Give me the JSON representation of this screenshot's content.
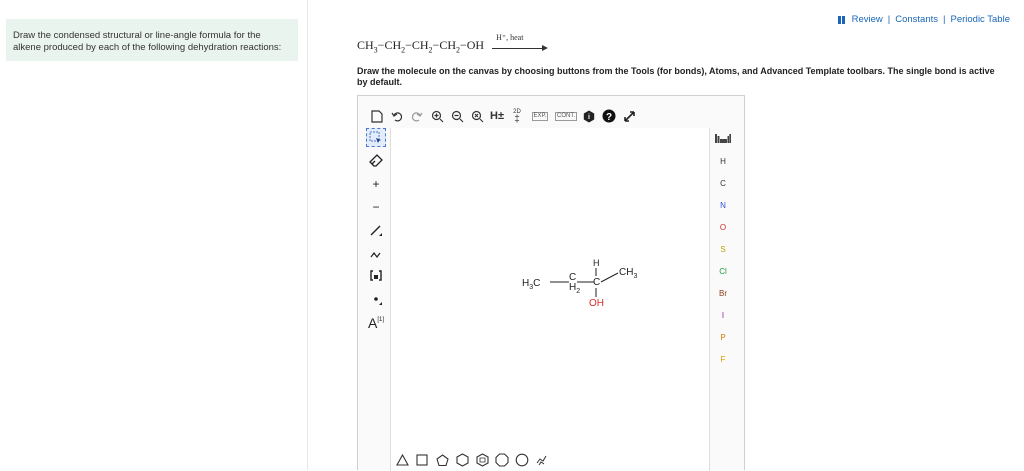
{
  "question": {
    "text": "Draw the condensed structural or line-angle formula for the alkene produced by each of the following dehydration reactions:"
  },
  "top_links": {
    "review": "Review",
    "constants": "Constants",
    "periodic_table": "Periodic Table",
    "separator": "|"
  },
  "reaction": {
    "reactant_parts": [
      "CH",
      "3",
      "−CH",
      "2",
      "−CH",
      "2",
      "−CH",
      "2",
      "−OH"
    ],
    "conditions": "H⁺, heat"
  },
  "instructions": "Draw the molecule on the canvas by choosing buttons from the Tools (for bonds), Atoms, and Advanced Template toolbars. The single bond is active by default.",
  "editor": {
    "top_toolbar": [
      "new-icon",
      "undo-icon",
      "redo-icon",
      "zoom-in-icon",
      "zoom-out-icon",
      "clean-icon",
      "hydrogen-toggle-icon",
      "2d-icon",
      "expand-icon",
      "contract-icon",
      "info-icon",
      "help-icon",
      "fullscreen-icon"
    ],
    "top_toolbar_labels": {
      "h_toggle": "H±",
      "d2": "2D",
      "exp": "EXP.",
      "cont": "CONT."
    },
    "left_toolbar": [
      "select-icon",
      "erase-icon",
      "plus-icon",
      "minus-icon",
      "single-bond-icon",
      "chain-icon",
      "bracket-icon",
      "radical-icon",
      "atom-label-icon"
    ],
    "left_toolbar_labels": {
      "plus": "+",
      "minus": "−",
      "atom_label": "A",
      "atom_label_sup": "[1]"
    },
    "atoms": [
      {
        "symbol": "H",
        "color": "#333333"
      },
      {
        "symbol": "C",
        "color": "#333333"
      },
      {
        "symbol": "N",
        "color": "#2c4dd6"
      },
      {
        "symbol": "O",
        "color": "#d62c2c"
      },
      {
        "symbol": "S",
        "color": "#b8a000"
      },
      {
        "symbol": "Cl",
        "color": "#1e9a3a"
      },
      {
        "symbol": "Br",
        "color": "#8a3a1a"
      },
      {
        "symbol": "I",
        "color": "#8a2a9a"
      },
      {
        "symbol": "P",
        "color": "#d97a00"
      },
      {
        "symbol": "F",
        "color": "#d9a000"
      }
    ],
    "periodic_table_icon": "periodic-table-icon",
    "bottom_toolbar": [
      "triangle-icon",
      "square-icon",
      "pentagon-icon",
      "hexagon-icon",
      "heptagon-icon",
      "octagon-icon",
      "cyclopentadiene-icon",
      "template-icon"
    ],
    "molecule": {
      "h3c": "H",
      "h3c_sub": "3",
      "h3c_c": "C",
      "ch2_c": "C",
      "ch2_h": "H",
      "ch2_sub": "2",
      "ch_h": "H",
      "ch_c": "C",
      "ch3": "CH",
      "ch3_sub": "3",
      "oh": "OH",
      "oh_color": "#d62c2c"
    }
  }
}
